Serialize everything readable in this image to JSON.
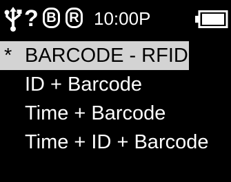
{
  "status_bar": {
    "usb_icon": "usb-icon",
    "help_glyph": "?",
    "badge_b": "B",
    "badge_r": "R",
    "time": "10:00P",
    "battery_icon": "battery-icon",
    "battery_level": 1.0
  },
  "menu": {
    "selected_marker": "*",
    "items": [
      {
        "label": "BARCODE - RFID",
        "selected": true
      },
      {
        "label": "ID + Barcode",
        "selected": false
      },
      {
        "label": "Time + Barcode",
        "selected": false
      },
      {
        "label": "Time + ID + Barcode",
        "selected": false
      }
    ]
  },
  "colors": {
    "background": "#000000",
    "text": "#ffffff",
    "selection_background": "#d3d3d3",
    "selection_text": "#000000"
  }
}
